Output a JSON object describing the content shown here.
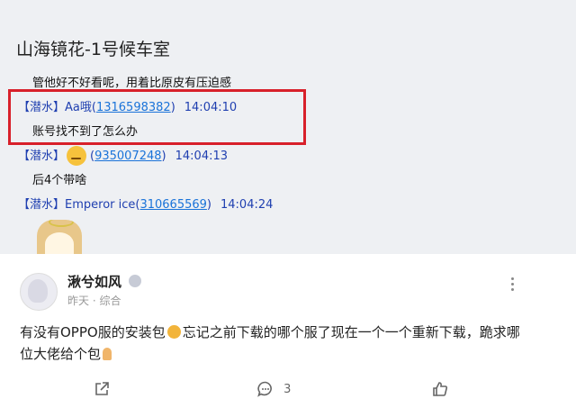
{
  "chat": {
    "title": "山海镜花-1号候车室",
    "msg1": "管他好不好看呢，用着比原皮有压迫感",
    "m2": {
      "tag": "【潜水】",
      "name": "Aa哦",
      "qq": "1316598382",
      "time": "14:04:10",
      "text": "账号找不到了怎么办"
    },
    "m3": {
      "tag": "【潜水】",
      "qq": "935007248",
      "time": "14:04:13",
      "text": "后4个带啥"
    },
    "m4": {
      "tag": "【潜水】",
      "name": "Emperor ice",
      "qq": "310665569",
      "time": "14:04:24"
    }
  },
  "post": {
    "username": "湫兮如风",
    "meta": "昨天 · 综合",
    "content_a": "有没有OPPO服的安装包",
    "content_b": "忘记之前下载的哪个服了现在一个一个重新下载，跪求哪位大佬给个包",
    "comment_count": "3"
  },
  "colors": {
    "highlight": "#d8202a",
    "link": "#1a73d9",
    "name": "#1f3fb0"
  }
}
